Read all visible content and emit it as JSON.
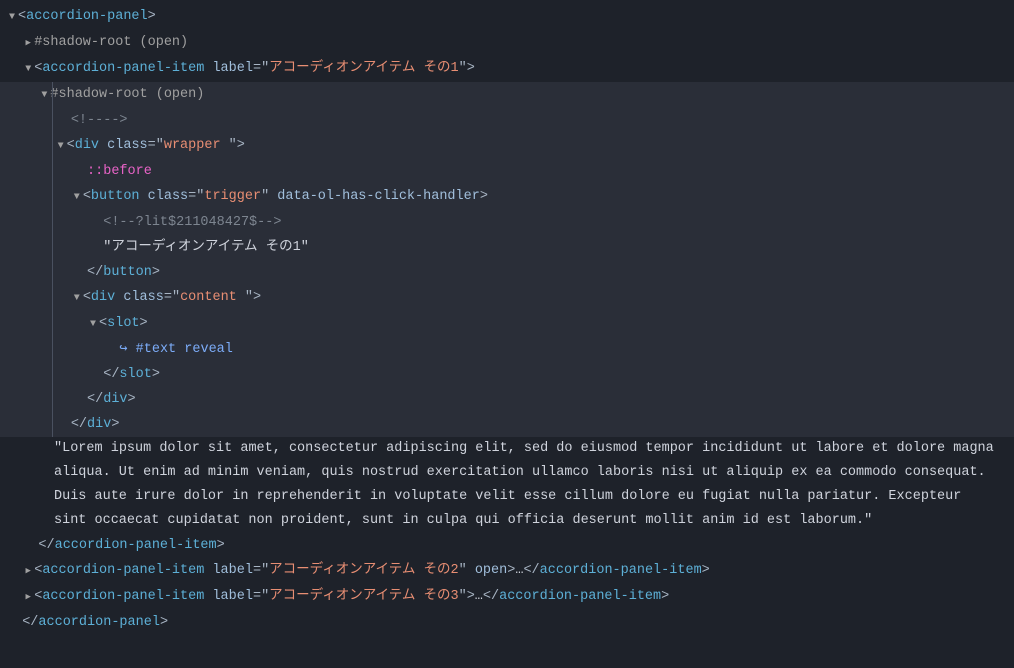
{
  "dom": {
    "shadowRoot": "#shadow-root (open)",
    "commentEmpty": "<!---->",
    "litComment": "<!--?lit$211048427$-->",
    "textReveal": "#text reveal",
    "pseudoBefore": "::before",
    "ellipsis": "…",
    "tags": {
      "accordionPanel": "accordion-panel",
      "accordionPanelItem": "accordion-panel-item",
      "div": "div",
      "button": "button",
      "slot": "slot"
    },
    "attrs": {
      "label": "label",
      "class": "class",
      "open": "open",
      "dataHandler": "data-ol-has-click-handler"
    },
    "values": {
      "item1": "アコーディオンアイテム その1",
      "item2": "アコーディオンアイテム その2",
      "item3": "アコーディオンアイテム その3",
      "wrapper": "wrapper ",
      "trigger": "trigger",
      "content": "content "
    },
    "buttonText": "アコーディオンアイテム その1",
    "lipsum": "Lorem ipsum dolor sit amet, consectetur adipiscing elit, sed do eiusmod tempor incididunt ut labore et dolore magna aliqua. Ut enim ad minim veniam, quis nostrud exercitation ullamco laboris nisi ut aliquip ex ea commodo consequat. Duis aute irure dolor in reprehenderit in voluptate velit esse cillum dolore eu fugiat nulla pariatur. Excepteur sint occaecat cupidatat non proident, sunt in culpa qui officia deserunt mollit anim id est laborum."
  }
}
